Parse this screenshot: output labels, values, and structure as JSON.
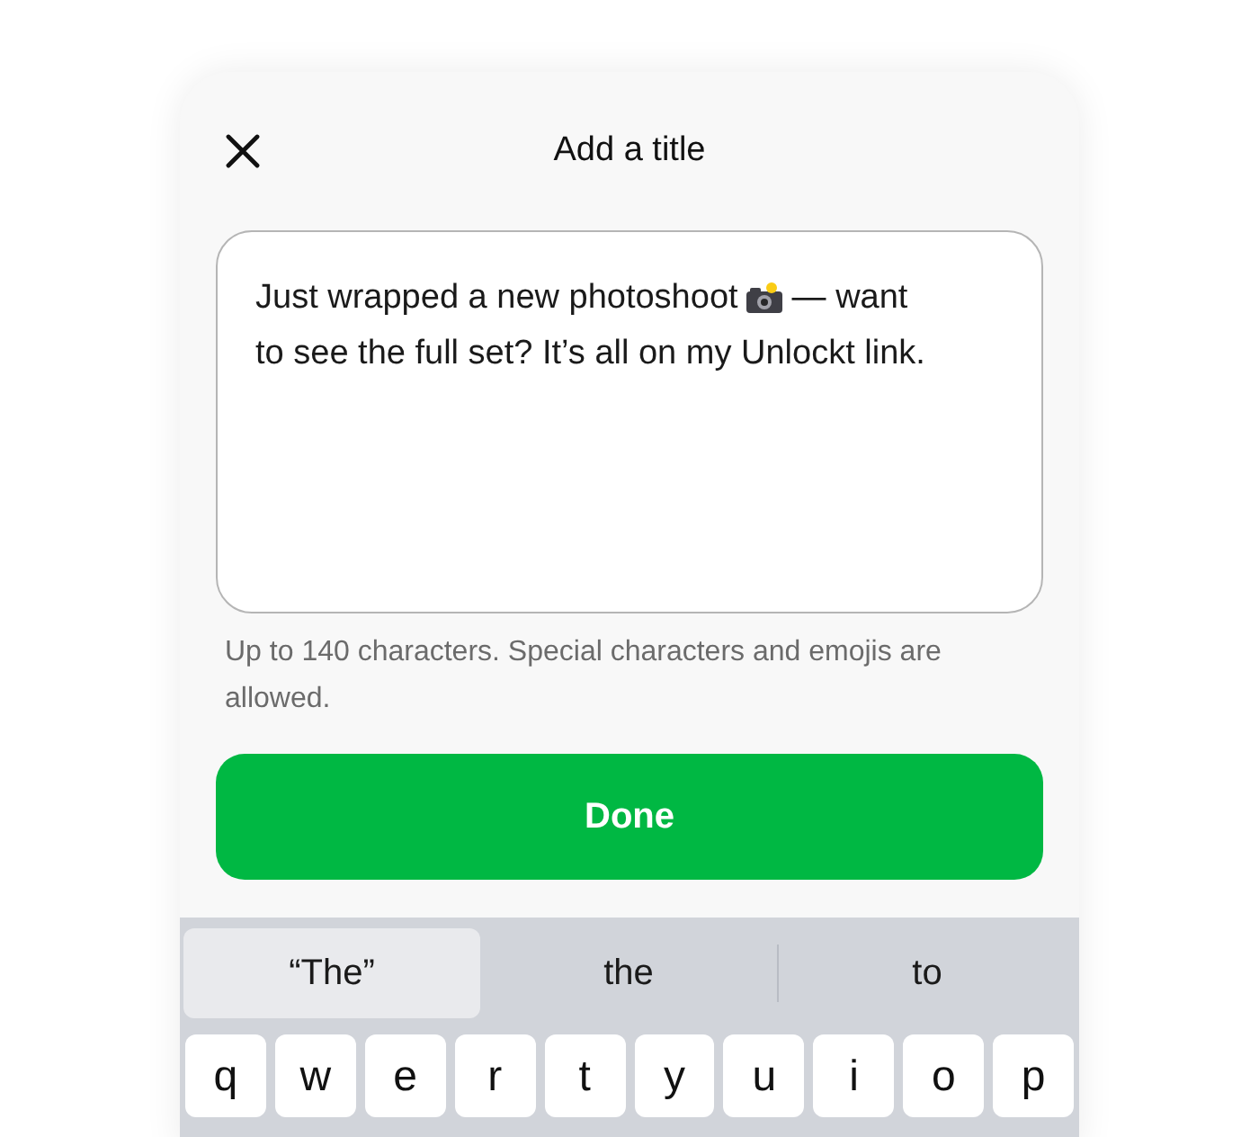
{
  "header": {
    "title": "Add a title"
  },
  "title_field": {
    "text_before": "Just wrapped a new photoshoot",
    "text_after_icon": "— want",
    "text_continued": "to see the full set? It’s all on my Unlockt link."
  },
  "helper_text": "Up to 140 characters. Special characters and emojis are allowed.",
  "done_button": {
    "label": "Done"
  },
  "keyboard": {
    "suggestions": [
      {
        "label": "“The”",
        "selected": true
      },
      {
        "label": "the",
        "selected": false
      },
      {
        "label": "to",
        "selected": false
      }
    ],
    "keys": [
      "q",
      "w",
      "e",
      "r",
      "t",
      "y",
      "u",
      "i",
      "o",
      "p"
    ]
  }
}
